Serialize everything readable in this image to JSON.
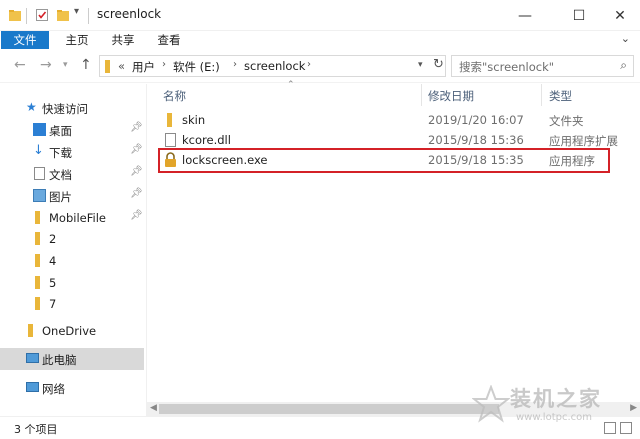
{
  "window": {
    "title": "screenlock",
    "controls": {
      "minimize": "—",
      "maximize": "☐",
      "close": "✕"
    }
  },
  "ribbon": {
    "tabs": [
      "文件",
      "主页",
      "共享",
      "查看"
    ]
  },
  "address_bar": {
    "prefix": "«",
    "crumbs": [
      "用户",
      "软件 (E:)",
      "screenlock"
    ],
    "search_placeholder": "搜索\"screenlock\""
  },
  "navigation": {
    "quick_access_label": "快速访问",
    "pinned": [
      {
        "label": "桌面",
        "icon": "desktop-icon"
      },
      {
        "label": "下载",
        "icon": "download-icon"
      },
      {
        "label": "文档",
        "icon": "document-icon"
      },
      {
        "label": "图片",
        "icon": "pictures-icon"
      },
      {
        "label": "MobileFile",
        "icon": "folder-icon"
      }
    ],
    "folders": [
      "2",
      "4",
      "5",
      "7"
    ],
    "onedrive_label": "OneDrive",
    "this_pc_label": "此电脑",
    "network_label": "网络"
  },
  "file_list": {
    "columns": {
      "name": "名称",
      "date": "修改日期",
      "type": "类型"
    },
    "rows": [
      {
        "name": "skin",
        "date": "2019/1/20 16:07",
        "type": "文件夹",
        "icon": "folder-icon"
      },
      {
        "name": "kcore.dll",
        "date": "2015/9/18 15:36",
        "type": "应用程序扩展",
        "icon": "dll-file-icon"
      },
      {
        "name": "lockscreen.exe",
        "date": "2015/9/18 15:35",
        "type": "应用程序",
        "icon": "lock-exe-icon",
        "highlighted": true
      }
    ]
  },
  "status": {
    "item_count": "3 个项目"
  },
  "watermark": {
    "main": "装机之家",
    "sub": "www.lotpc.com"
  },
  "colors": {
    "accent": "#1979ca",
    "highlight_border": "#d42127",
    "folder": "#f0c24b"
  }
}
